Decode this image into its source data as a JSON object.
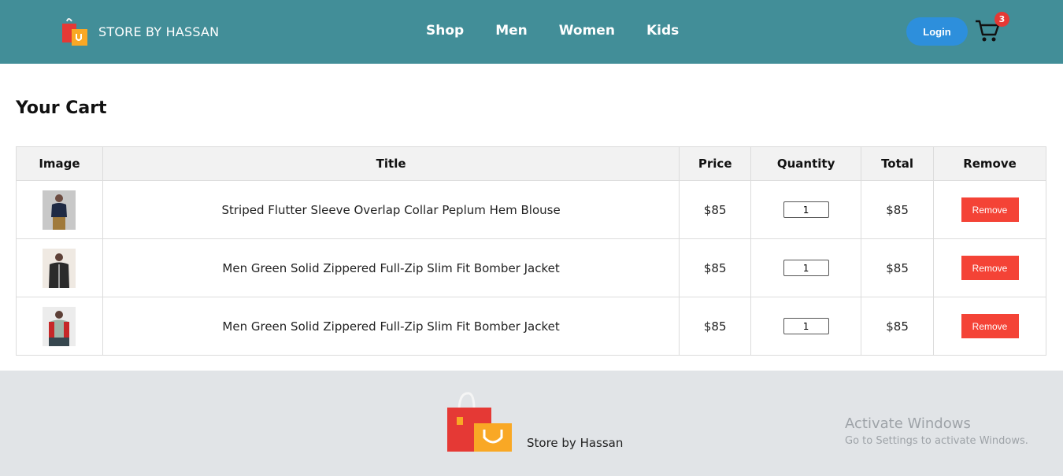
{
  "header": {
    "brand_name": "STORE BY HASSAN",
    "nav": [
      "Shop",
      "Men",
      "Women",
      "Kids"
    ],
    "login_label": "Login",
    "cart_count": "3"
  },
  "cart": {
    "title": "Your Cart",
    "columns": [
      "Image",
      "Title",
      "Price",
      "Quantity",
      "Total",
      "Remove"
    ],
    "rows": [
      {
        "title": "Striped Flutter Sleeve Overlap Collar Peplum Hem Blouse",
        "price": "$85",
        "quantity": "1",
        "total": "$85",
        "remove": "Remove"
      },
      {
        "title": "Men Green Solid Zippered Full-Zip Slim Fit Bomber Jacket",
        "price": "$85",
        "quantity": "1",
        "total": "$85",
        "remove": "Remove"
      },
      {
        "title": "Men Green Solid Zippered Full-Zip Slim Fit Bomber Jacket",
        "price": "$85",
        "quantity": "1",
        "total": "$85",
        "remove": "Remove"
      }
    ]
  },
  "footer": {
    "brand_name": "Store by Hassan"
  },
  "watermark": {
    "title": "Activate Windows",
    "subtitle": "Go to Settings to activate Windows."
  },
  "colors": {
    "header_bg": "#428e98",
    "login_button": "#2d8fdc",
    "badge": "#e53935",
    "remove_button": "#f44336",
    "footer_bg": "#e1e4e7"
  },
  "icons": {
    "brand": "shopping-bags-icon",
    "cart": "shopping-cart-icon"
  }
}
